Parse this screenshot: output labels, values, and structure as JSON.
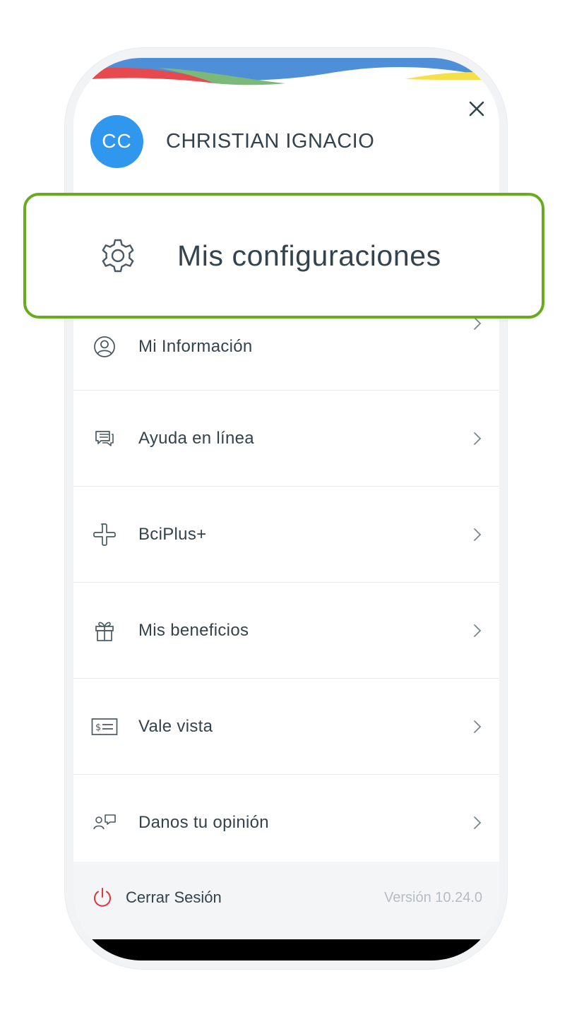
{
  "profile": {
    "initials": "CC",
    "name": "CHRISTIAN IGNACIO"
  },
  "highlight": {
    "label": "Mis configuraciones",
    "icon": "gear-icon",
    "border_color": "#6aaa1f"
  },
  "menu": {
    "items": [
      {
        "label": "Mi Información",
        "icon": "user-circle-icon"
      },
      {
        "label": "Ayuda en línea",
        "icon": "chat-icon"
      },
      {
        "label": "BciPlus+",
        "icon": "plus-outline-icon"
      },
      {
        "label": "Mis beneficios",
        "icon": "gift-icon"
      },
      {
        "label": "Vale vista",
        "icon": "money-ticket-icon"
      },
      {
        "label": "Danos tu opinión",
        "icon": "feedback-icon"
      }
    ]
  },
  "footer": {
    "logout_label": "Cerrar Sesión",
    "version": "Versión 10.24.0"
  },
  "colors": {
    "avatar": "#2f97ee",
    "logout_icon": "#e0353b",
    "wave_red": "#e64a4f",
    "wave_green": "#7cb87a",
    "wave_blue": "#4f8fd8",
    "wave_yellow": "#f6e04a"
  }
}
